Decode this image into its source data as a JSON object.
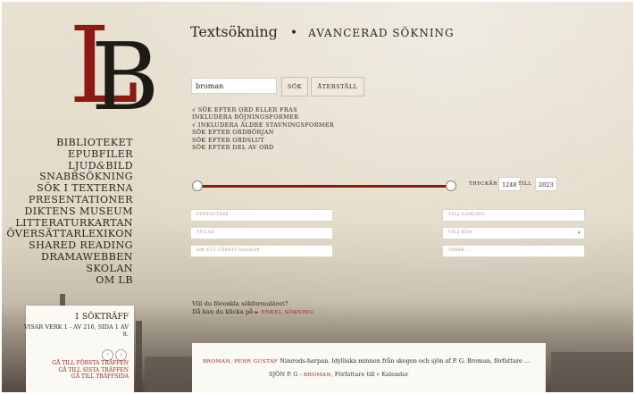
{
  "logo": {
    "l": "L",
    "b": "B"
  },
  "nav": [
    {
      "label": "BIBLIOTEKET"
    },
    {
      "label": "EPUBFILER"
    },
    {
      "label_a": "LJUD",
      "label_amp": "&",
      "label_b": "BILD"
    },
    {
      "label": "SNABBSÖKNING"
    },
    {
      "label": "SÖK I TEXTERNA"
    },
    {
      "label": "PRESENTATIONER"
    },
    {
      "label": "DIKTENS MUSEUM"
    },
    {
      "label": "LITTERATURKARTAN"
    },
    {
      "label": "ÖVERSÄTTARLEXIKON"
    },
    {
      "label": "SHARED READING"
    },
    {
      "label": "DRAMAWEBBEN"
    },
    {
      "label": "SKOLAN"
    },
    {
      "label": "OM LB"
    }
  ],
  "hits": {
    "title": "1 SÖKTRÄFF",
    "count": "VISAR VERK 1 - AV 216, SIDA 1 AV 8.",
    "prev_icon": "chevron-left-icon",
    "next_icon": "chevron-right-icon",
    "prev_glyph": "‹",
    "next_glyph": "›",
    "links": [
      "GÅ TILL FÖRSTA TRÄFFEN",
      "GÅ TILL SISTA TRÄFFEN",
      "GÅ TILL TRÄFFSIDA"
    ]
  },
  "header": {
    "title": "Textsökning",
    "separator": "•",
    "advanced": "AVANCERAD SÖKNING"
  },
  "search": {
    "value": "broman",
    "search_button": "SÖK",
    "reset_button": "ÅTERSTÄLL"
  },
  "options": [
    "√ SÖK EFTER ORD ELLER FRAS",
    "INKLUDERA BÖJNINGSFORMER",
    "√ INKLUDERA ÄLDRE STAVNINGSFORMER",
    "SÖK EFTER ORDBÖRJAN",
    "SÖK EFTER ORDSLUT",
    "SÖK EFTER DEL AV ORD"
  ],
  "years": {
    "label_from": "TRYCKÅR",
    "from": "1248",
    "label_to": "TILL",
    "to": "2023",
    "range_start_fraction": 0.0,
    "range_end_fraction": 1.0
  },
  "filters": {
    "author": "FÖRFATTARE",
    "collection": "VÄLJ SAMLING",
    "titles": "TITLAR",
    "gender": "VÄLJ KÖN",
    "about_author": "OM ETT FÖRFATTARSKAP",
    "language": "SPRÅK ..."
  },
  "simple": {
    "line1": "Vill du förenkla sökformuläret?",
    "line2": "Då kan du klicka på",
    "link": "► ENKEL SÖKNING"
  },
  "result": {
    "author": "BROMAN, PEHR GUSTAF",
    "title": "Nimrods-harpan. Idylliska minnen från skogen och sjön af P. G. Broman, författare ...",
    "context_before": "SJÖN P. G -",
    "hit": "BROMAN,",
    "context_after": "Författare till » Kalender"
  },
  "colors": {
    "accent": "#9e1a14",
    "logo_red": "#8b1a15"
  }
}
